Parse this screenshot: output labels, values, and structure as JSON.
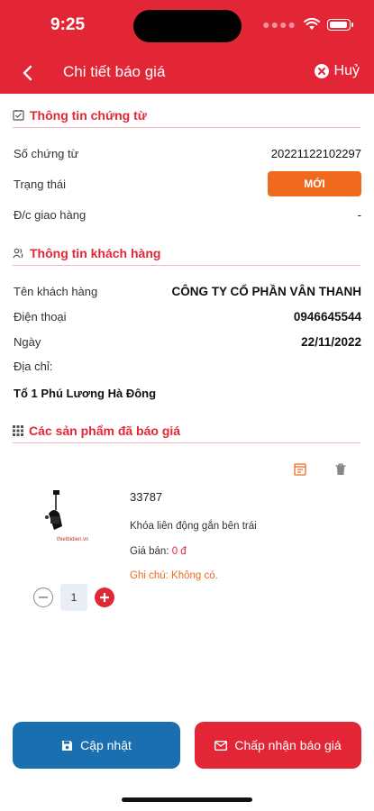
{
  "status_bar": {
    "time": "9:25"
  },
  "header": {
    "title": "Chi tiết báo giá",
    "cancel_label": "Huỷ"
  },
  "document_info": {
    "section_title": "Thông tin chứng từ",
    "doc_number_label": "Số chứng từ",
    "doc_number_value": "20221122102297",
    "status_label": "Trạng thái",
    "status_value": "MỚI",
    "delivery_label": "Đ/c giao hàng",
    "delivery_value": "-"
  },
  "customer_info": {
    "section_title": "Thông tin khách hàng",
    "name_label": "Tên khách hàng",
    "name_value": "CÔNG TY CỔ PHẦN VÂN THANH",
    "phone_label": "Điện thoại",
    "phone_value": "0946645544",
    "date_label": "Ngày",
    "date_value": "22/11/2022",
    "address_label": "Địa chỉ:",
    "address_value": "Tổ 1 Phú Lương Hà Đông"
  },
  "products": {
    "section_title": "Các sản phẩm đã báo giá",
    "items": [
      {
        "code": "33787",
        "name": "Khóa liên động gắn bên trái",
        "price_label": "Giá bán:",
        "price_value": "0 đ",
        "note": "Ghi chú: Không có.",
        "quantity": "1",
        "image_caption": "thietbidien.vn"
      }
    ]
  },
  "actions": {
    "update_label": "Cập nhật",
    "accept_label": "Chấp nhận báo giá"
  },
  "colors": {
    "primary_red": "#e32636",
    "status_orange": "#ef6a1f",
    "update_blue": "#1a6fb0"
  }
}
